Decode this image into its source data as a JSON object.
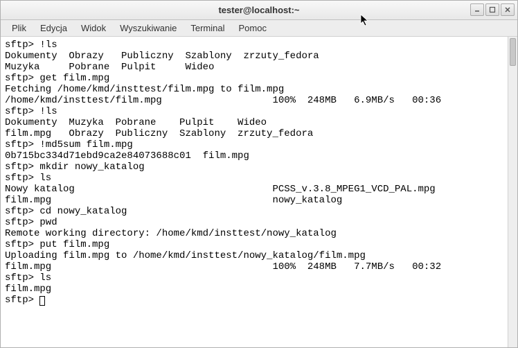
{
  "window": {
    "title": "tester@localhost:~"
  },
  "menu": {
    "file": "Plik",
    "edit": "Edycja",
    "view": "Widok",
    "search": "Wyszukiwanie",
    "terminal": "Terminal",
    "help": "Pomoc"
  },
  "terminal": {
    "lines": [
      "sftp> !ls",
      "Dokumenty  Obrazy   Publiczny  Szablony  zrzuty_fedora",
      "Muzyka     Pobrane  Pulpit     Wideo",
      "sftp> get film.mpg",
      "Fetching /home/kmd/insttest/film.mpg to film.mpg",
      "/home/kmd/insttest/film.mpg                   100%  248MB   6.9MB/s   00:36",
      "sftp> !ls",
      "Dokumenty  Muzyka  Pobrane    Pulpit    Wideo",
      "film.mpg   Obrazy  Publiczny  Szablony  zrzuty_fedora",
      "sftp> !md5sum film.mpg",
      "0b715bc334d71ebd9ca2e84073688c01  film.mpg",
      "sftp> mkdir nowy_katalog",
      "sftp> ls",
      "Nowy katalog                                  PCSS_v.3.8_MPEG1_VCD_PAL.mpg",
      "film.mpg                                      nowy_katalog",
      "sftp> cd nowy_katalog",
      "sftp> pwd",
      "Remote working directory: /home/kmd/insttest/nowy_katalog",
      "sftp> put film.mpg",
      "Uploading film.mpg to /home/kmd/insttest/nowy_katalog/film.mpg",
      "film.mpg                                      100%  248MB   7.7MB/s   00:32",
      "sftp> ls",
      "film.mpg",
      "sftp> "
    ]
  }
}
